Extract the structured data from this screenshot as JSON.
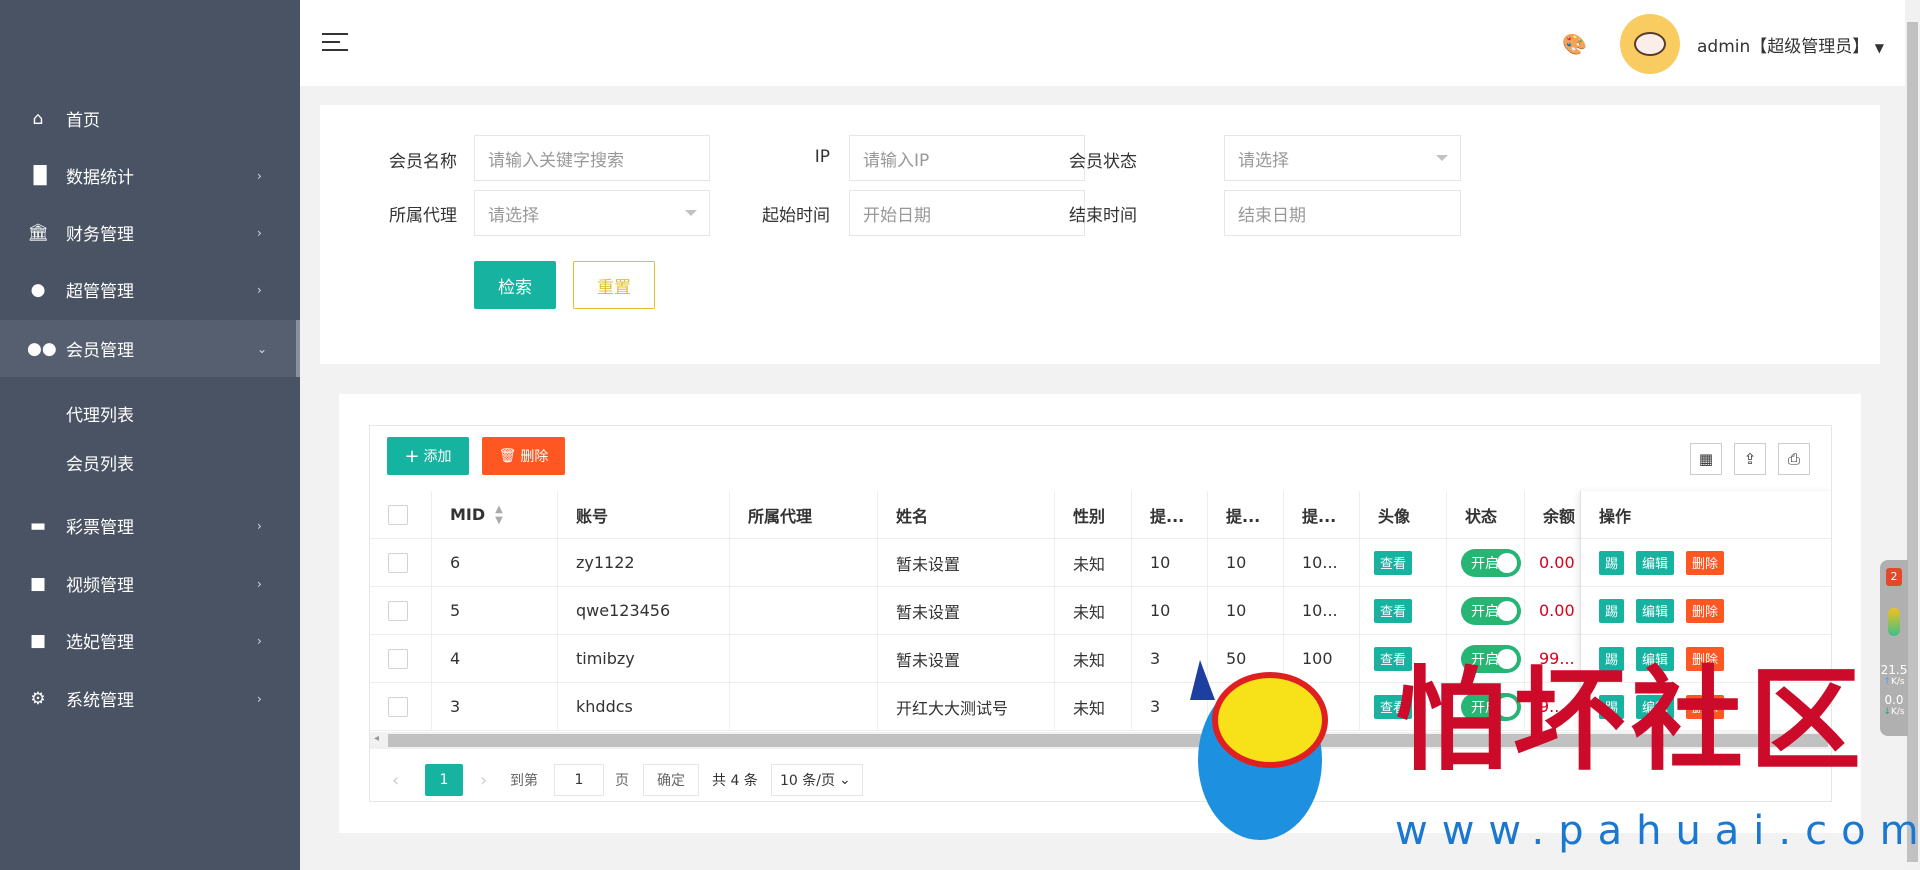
{
  "sidebar": {
    "items": [
      {
        "label": "首页",
        "icon": "home-icon"
      },
      {
        "label": "数据统计",
        "icon": "bar-chart-icon"
      },
      {
        "label": "财务管理",
        "icon": "bank-icon"
      },
      {
        "label": "超管管理",
        "icon": "user-icon"
      },
      {
        "label": "会员管理",
        "icon": "users-icon",
        "expanded": true
      },
      {
        "label": "彩票管理",
        "icon": "gamepad-icon"
      },
      {
        "label": "视频管理",
        "icon": "video-icon"
      },
      {
        "label": "选妃管理",
        "icon": "video-icon"
      },
      {
        "label": "系统管理",
        "icon": "gear-icon"
      }
    ],
    "sub_items": [
      "代理列表",
      "会员列表"
    ]
  },
  "header": {
    "user": "admin【超级管理员】"
  },
  "search": {
    "member_name_label": "会员名称",
    "member_name_placeholder": "请输入关键字搜索",
    "ip_label": "IP",
    "ip_placeholder": "请输入IP",
    "status_label": "会员状态",
    "status_placeholder": "请选择",
    "agent_label": "所属代理",
    "agent_placeholder": "请选择",
    "start_label": "起始时间",
    "start_placeholder": "开始日期",
    "end_label": "结束时间",
    "end_placeholder": "结束日期",
    "search_btn": "检索",
    "reset_btn": "重置"
  },
  "toolbar": {
    "add": "添加",
    "delete": "删除"
  },
  "table": {
    "columns": [
      "MID",
      "账号",
      "所属代理",
      "姓名",
      "性别",
      "提...",
      "提...",
      "提...",
      "头像",
      "状态",
      "余额",
      "操作"
    ],
    "rows": [
      {
        "mid": "6",
        "account": "zy1122",
        "agent": "",
        "name": "暂未设置",
        "gender": "未知",
        "t1": "10",
        "t2": "10",
        "t3": "10...",
        "balance": "0.00"
      },
      {
        "mid": "5",
        "account": "qwe123456",
        "agent": "",
        "name": "暂未设置",
        "gender": "未知",
        "t1": "10",
        "t2": "10",
        "t3": "10...",
        "balance": "0.00"
      },
      {
        "mid": "4",
        "account": "timibzy",
        "agent": "",
        "name": "暂未设置",
        "gender": "未知",
        "t1": "3",
        "t2": "50",
        "t3": "100",
        "balance": "99..."
      },
      {
        "mid": "3",
        "account": "khddcs",
        "agent": "",
        "name": "开红大大测试号",
        "gender": "未知",
        "t1": "3",
        "t2": "5",
        "t3": "",
        "balance": "9..."
      }
    ],
    "view": "查看",
    "status_on": "开启",
    "kick": "踢",
    "edit": "编辑",
    "del": "删除"
  },
  "pager": {
    "current": "1",
    "goto": "到第",
    "page_value": "1",
    "page_unit": "页",
    "confirm": "确定",
    "total": "共 4 条",
    "page_size": "10 条/页"
  },
  "widget": {
    "badge": "2",
    "up": "21.5",
    "up_unit": "K/s",
    "down": "0.0",
    "down_unit": "K/s"
  },
  "watermark": {
    "text": "怕坏社区",
    "url": "www.pahuai.com"
  },
  "colors": {
    "sidebar": "#4a5364",
    "primary": "#16b3a0",
    "danger": "#ff5722",
    "reset": "#e0c12a",
    "status": "#26b573",
    "balance": "#d9001b"
  }
}
